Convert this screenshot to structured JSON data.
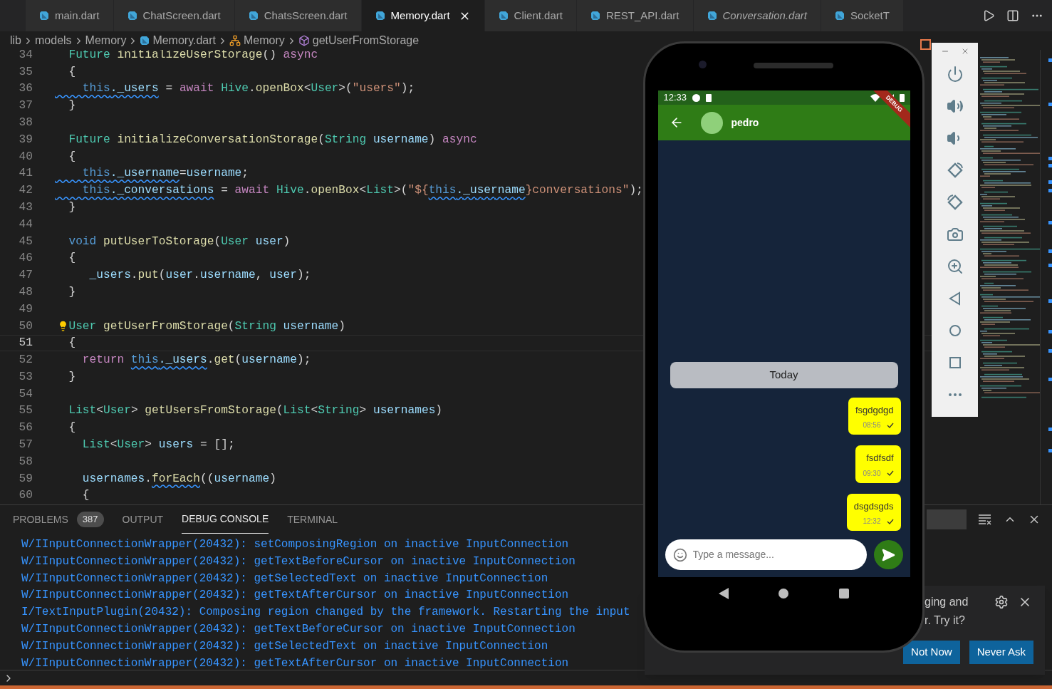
{
  "tabs": [
    {
      "label": "main.dart",
      "selected": false,
      "preview": false
    },
    {
      "label": "ChatScreen.dart",
      "selected": false,
      "preview": false
    },
    {
      "label": "ChatsScreen.dart",
      "selected": false,
      "preview": false
    },
    {
      "label": "Memory.dart",
      "selected": true,
      "preview": false
    },
    {
      "label": "Client.dart",
      "selected": false,
      "preview": false
    },
    {
      "label": "REST_API.dart",
      "selected": false,
      "preview": false
    },
    {
      "label": "Conversation.dart",
      "selected": false,
      "preview": true
    },
    {
      "label": "SocketT",
      "selected": false,
      "preview": false
    }
  ],
  "breadcrumbs": [
    {
      "label": "lib",
      "kind": "folder"
    },
    {
      "label": "models",
      "kind": "folder"
    },
    {
      "label": "Memory",
      "kind": "folder"
    },
    {
      "label": "Memory.dart",
      "kind": "file"
    },
    {
      "label": "Memory",
      "kind": "class"
    },
    {
      "label": "getUserFromStorage",
      "kind": "method"
    }
  ],
  "code_lines": [
    {
      "n": "34",
      "current": false,
      "lightbulb": false,
      "tokens": [
        {
          "text": "  Future ",
          "kind": "t"
        },
        {
          "text": "initializeUserStorage",
          "kind": "f"
        },
        {
          "text": "() ",
          "kind": "p"
        },
        {
          "text": "async",
          "kind": "c"
        }
      ]
    },
    {
      "n": "35",
      "current": false,
      "lightbulb": false,
      "tokens": [
        {
          "text": "  {",
          "kind": "p"
        }
      ]
    },
    {
      "n": "36",
      "current": false,
      "lightbulb": false,
      "tokens": [
        {
          "text": "    this",
          "kind": "tw"
        },
        {
          "text": "._users",
          "kind": "vw"
        },
        {
          "text": " = ",
          "kind": "p"
        },
        {
          "text": "await ",
          "kind": "c"
        },
        {
          "text": "Hive",
          "kind": "t"
        },
        {
          "text": ".",
          "kind": "p"
        },
        {
          "text": "openBox",
          "kind": "f"
        },
        {
          "text": "<",
          "kind": "p"
        },
        {
          "text": "User",
          "kind": "t"
        },
        {
          "text": ">(",
          "kind": "p"
        },
        {
          "text": "\"users\"",
          "kind": "s"
        },
        {
          "text": ");",
          "kind": "p"
        }
      ]
    },
    {
      "n": "37",
      "current": false,
      "lightbulb": false,
      "tokens": [
        {
          "text": "  }",
          "kind": "p"
        }
      ]
    },
    {
      "n": "38",
      "current": false,
      "lightbulb": false
    },
    {
      "n": "39",
      "current": false,
      "lightbulb": false,
      "tokens": [
        {
          "text": "  Future ",
          "kind": "t"
        },
        {
          "text": "initializeConversationStorage",
          "kind": "f"
        },
        {
          "text": "(",
          "kind": "p"
        },
        {
          "text": "String ",
          "kind": "t"
        },
        {
          "text": "username",
          "kind": "v"
        },
        {
          "text": ") ",
          "kind": "p"
        },
        {
          "text": "async",
          "kind": "c"
        }
      ]
    },
    {
      "n": "40",
      "current": false,
      "lightbulb": false,
      "tokens": [
        {
          "text": "  {",
          "kind": "p"
        }
      ]
    },
    {
      "n": "41",
      "current": false,
      "lightbulb": false,
      "tokens": [
        {
          "text": "    this",
          "kind": "tw"
        },
        {
          "text": "._username",
          "kind": "vw"
        },
        {
          "text": "=",
          "kind": "p"
        },
        {
          "text": "username",
          "kind": "v"
        },
        {
          "text": ";",
          "kind": "p"
        }
      ]
    },
    {
      "n": "42",
      "current": false,
      "lightbulb": false,
      "tokens": [
        {
          "text": "    this",
          "kind": "tw"
        },
        {
          "text": "._conversations",
          "kind": "vw"
        },
        {
          "text": " = ",
          "kind": "p"
        },
        {
          "text": "await ",
          "kind": "c"
        },
        {
          "text": "Hive",
          "kind": "t"
        },
        {
          "text": ".",
          "kind": "p"
        },
        {
          "text": "openBox",
          "kind": "f"
        },
        {
          "text": "<",
          "kind": "p"
        },
        {
          "text": "List",
          "kind": "t"
        },
        {
          "text": ">(",
          "kind": "p"
        },
        {
          "text": "\"${",
          "kind": "s"
        },
        {
          "text": "this",
          "kind": "tw"
        },
        {
          "text": "._username",
          "kind": "vw"
        },
        {
          "text": "}conversations\"",
          "kind": "s"
        },
        {
          "text": ");",
          "kind": "p"
        }
      ]
    },
    {
      "n": "43",
      "current": false,
      "lightbulb": false,
      "tokens": [
        {
          "text": "  }",
          "kind": "p"
        }
      ]
    },
    {
      "n": "44",
      "current": false,
      "lightbulb": false
    },
    {
      "n": "45",
      "current": false,
      "lightbulb": false,
      "tokens": [
        {
          "text": "  void ",
          "kind": "k"
        },
        {
          "text": "putUserToStorage",
          "kind": "f"
        },
        {
          "text": "(",
          "kind": "p"
        },
        {
          "text": "User ",
          "kind": "t"
        },
        {
          "text": "user",
          "kind": "v"
        },
        {
          "text": ")",
          "kind": "p"
        }
      ]
    },
    {
      "n": "46",
      "current": false,
      "lightbulb": false,
      "tokens": [
        {
          "text": "  {",
          "kind": "p"
        }
      ]
    },
    {
      "n": "47",
      "current": false,
      "lightbulb": false,
      "tokens": [
        {
          "text": "     _users",
          "kind": "v"
        },
        {
          "text": ".",
          "kind": "p"
        },
        {
          "text": "put",
          "kind": "f"
        },
        {
          "text": "(",
          "kind": "p"
        },
        {
          "text": "user",
          "kind": "v"
        },
        {
          "text": ".",
          "kind": "p"
        },
        {
          "text": "username",
          "kind": "v"
        },
        {
          "text": ", ",
          "kind": "p"
        },
        {
          "text": "user",
          "kind": "v"
        },
        {
          "text": ");",
          "kind": "p"
        }
      ]
    },
    {
      "n": "48",
      "current": false,
      "lightbulb": false,
      "tokens": [
        {
          "text": "  }",
          "kind": "p"
        }
      ]
    },
    {
      "n": "49",
      "current": false,
      "lightbulb": false
    },
    {
      "n": "50",
      "current": false,
      "lightbulb": true,
      "tokens": [
        {
          "text": "User ",
          "kind": "t"
        },
        {
          "text": "getUserFromStorage",
          "kind": "f"
        },
        {
          "text": "(",
          "kind": "p"
        },
        {
          "text": "String ",
          "kind": "t"
        },
        {
          "text": "username",
          "kind": "v"
        },
        {
          "text": ")",
          "kind": "p"
        }
      ]
    },
    {
      "n": "51",
      "current": true,
      "lightbulb": false,
      "tokens": [
        {
          "text": "  {",
          "kind": "p"
        }
      ]
    },
    {
      "n": "52",
      "current": false,
      "lightbulb": false,
      "tokens": [
        {
          "text": "    return ",
          "kind": "c"
        },
        {
          "text": "this",
          "kind": "tw"
        },
        {
          "text": "._users",
          "kind": "vw"
        },
        {
          "text": ".",
          "kind": "p"
        },
        {
          "text": "get",
          "kind": "f"
        },
        {
          "text": "(",
          "kind": "p"
        },
        {
          "text": "username",
          "kind": "v"
        },
        {
          "text": ");",
          "kind": "p"
        }
      ]
    },
    {
      "n": "53",
      "current": false,
      "lightbulb": false,
      "tokens": [
        {
          "text": "  }",
          "kind": "p"
        }
      ]
    },
    {
      "n": "54",
      "current": false,
      "lightbulb": false
    },
    {
      "n": "55",
      "current": false,
      "lightbulb": false,
      "tokens": [
        {
          "text": "  List",
          "kind": "t"
        },
        {
          "text": "<",
          "kind": "p"
        },
        {
          "text": "User",
          "kind": "t"
        },
        {
          "text": "> ",
          "kind": "p"
        },
        {
          "text": "getUsersFromStorage",
          "kind": "f"
        },
        {
          "text": "(",
          "kind": "p"
        },
        {
          "text": "List",
          "kind": "t"
        },
        {
          "text": "<",
          "kind": "p"
        },
        {
          "text": "String",
          "kind": "t"
        },
        {
          "text": "> ",
          "kind": "p"
        },
        {
          "text": "usernames",
          "kind": "v"
        },
        {
          "text": ")",
          "kind": "p"
        }
      ]
    },
    {
      "n": "56",
      "current": false,
      "lightbulb": false,
      "tokens": [
        {
          "text": "  {",
          "kind": "p"
        }
      ]
    },
    {
      "n": "57",
      "current": false,
      "lightbulb": false,
      "tokens": [
        {
          "text": "    List",
          "kind": "t"
        },
        {
          "text": "<",
          "kind": "p"
        },
        {
          "text": "User",
          "kind": "t"
        },
        {
          "text": "> ",
          "kind": "p"
        },
        {
          "text": "users",
          "kind": "v"
        },
        {
          "text": " = [];",
          "kind": "p"
        }
      ]
    },
    {
      "n": "58",
      "current": false,
      "lightbulb": false
    },
    {
      "n": "59",
      "current": false,
      "lightbulb": false,
      "tokens": [
        {
          "text": "    usernames",
          "kind": "v"
        },
        {
          "text": ".",
          "kind": "p"
        },
        {
          "text": "forEach",
          "kind": "fw"
        },
        {
          "text": "((",
          "kind": "p"
        },
        {
          "text": "username",
          "kind": "v"
        },
        {
          "text": ")",
          "kind": "p"
        }
      ]
    },
    {
      "n": "60",
      "current": false,
      "lightbulb": false,
      "tokens": [
        {
          "text": "    {",
          "kind": "p"
        }
      ]
    }
  ],
  "panel": {
    "tabs": [
      {
        "label": "PROBLEMS",
        "badge": "387",
        "selected": false
      },
      {
        "label": "OUTPUT",
        "selected": false
      },
      {
        "label": "DEBUG CONSOLE",
        "selected": true
      },
      {
        "label": "TERMINAL",
        "selected": false
      }
    ],
    "console_lines": [
      "W/IInputConnectionWrapper(20432): setComposingRegion on inactive InputConnection",
      "W/IInputConnectionWrapper(20432): getTextBeforeCursor on inactive InputConnection",
      "W/IInputConnectionWrapper(20432): getSelectedText on inactive InputConnection",
      "W/IInputConnectionWrapper(20432): getTextAfterCursor on inactive InputConnection",
      "I/TextInputPlugin(20432): Composing region changed by the framework. Restarting the input",
      "W/IInputConnectionWrapper(20432): getTextBeforeCursor on inactive InputConnection",
      "W/IInputConnectionWrapper(20432): getSelectedText on inactive InputConnection",
      "W/IInputConnectionWrapper(20432): getTextAfterCursor on inactive InputConnection"
    ]
  },
  "notification": {
    "lines": [
      "ging and",
      "r. Try it?"
    ],
    "buttons": [
      "Not Now",
      "Never Ask"
    ]
  },
  "phone": {
    "time": "12:33",
    "debug_banner": "DEBUG",
    "contact": "pedro",
    "date_chip": "Today",
    "messages": [
      {
        "text": "fsgdgdgd",
        "time": "08:56"
      },
      {
        "text": "fsdfsdf",
        "time": "09:30"
      },
      {
        "text": "dsgdsgds",
        "time": "12:32"
      }
    ],
    "input": {
      "placeholder": "Type a message..."
    }
  }
}
